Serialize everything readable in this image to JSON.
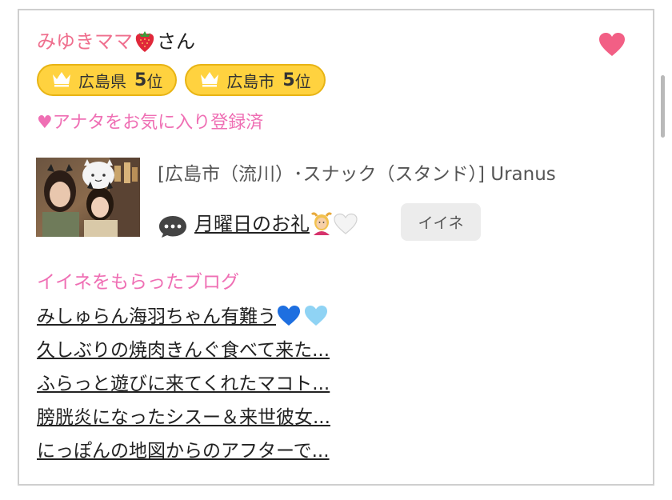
{
  "profile": {
    "name": "みゆきママ",
    "honorific": "さん",
    "name_emoji": "strawberry-emoji"
  },
  "favorite_button": {
    "icon": "heart-icon",
    "color": "#f25f85"
  },
  "rank_badges": [
    {
      "area": "広島県",
      "rank": "5",
      "suffix": "位",
      "icon": "crown-icon"
    },
    {
      "area": "広島市",
      "rank": "5",
      "suffix": "位",
      "icon": "crown-icon"
    }
  ],
  "favorite_status": "♥アナタをお気に入り登録済",
  "latest_post": {
    "shop": "[広島市（流川）･スナック（スタンド）]  Uranus",
    "title": "月曜日のお礼",
    "title_emojis": [
      "person-gesturing-ok-emoji",
      "white-heart-emoji"
    ],
    "comment_icon": "speech-bubble-icon",
    "like_button_label": "イイネ"
  },
  "liked_blogs": {
    "heading": "イイネをもらったブログ",
    "items": [
      {
        "title": "みしゅらん海羽ちゃん有難う",
        "emojis": [
          "blue-heart-emoji",
          "light-blue-heart-emoji"
        ]
      },
      {
        "title": "久しぶりの焼肉きんぐ食べて来た..."
      },
      {
        "title": "ふらっと遊びに来てくれたマコト..."
      },
      {
        "title": "膀胱炎になったシスー＆来世彼女..."
      },
      {
        "title": "にっぽんの地図からのアフターで..."
      }
    ]
  },
  "colors": {
    "name_pink": "#ef6f8e",
    "accent_pink": "#ef6fb4",
    "badge_yellow": "#ffd23f",
    "badge_border": "#e8b414"
  }
}
